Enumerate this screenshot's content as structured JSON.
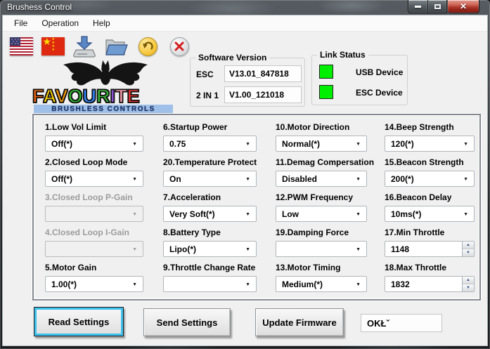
{
  "window": {
    "title": "Brushess Control"
  },
  "menu_bar": {
    "items": [
      {
        "label": "File"
      },
      {
        "label": "Operation"
      },
      {
        "label": "Help"
      }
    ]
  },
  "toolbar": {
    "buttons": [
      {
        "name": "english-language",
        "icon": "us-flag"
      },
      {
        "name": "chinese-language",
        "icon": "china-flag"
      },
      {
        "name": "save",
        "icon": "save-disk"
      },
      {
        "name": "open",
        "icon": "open-folder"
      },
      {
        "name": "undo",
        "icon": "undo-arrow"
      },
      {
        "name": "cancel",
        "icon": "cancel-x"
      }
    ]
  },
  "logo": {
    "text": "FAVOURITE",
    "letters": [
      {
        "ch": "F",
        "color": "#e8620c"
      },
      {
        "ch": "A",
        "color": "#ffd400"
      },
      {
        "ch": "V",
        "color": "#ff9d00"
      },
      {
        "ch": "O",
        "color": "#2eb82e"
      },
      {
        "ch": "U",
        "color": "#2e86ff"
      },
      {
        "ch": "R",
        "color": "#34b334"
      },
      {
        "ch": "I",
        "color": "#8a4fd3"
      },
      {
        "ch": "T",
        "color": "#ff9db0"
      },
      {
        "ch": "E",
        "color": "#e03131"
      }
    ],
    "subtitle": "BRUSHLESS CONTROLS"
  },
  "software_version": {
    "title": "Software Version",
    "rows": [
      {
        "label": "ESC",
        "value": "V13.01_847818"
      },
      {
        "label": "2 IN 1",
        "value": "V1.00_121018"
      }
    ]
  },
  "link_status": {
    "title": "Link Status",
    "indicator_color": "#00ee00",
    "items": [
      {
        "label": "USB Device"
      },
      {
        "label": "ESC Device"
      }
    ]
  },
  "settings": {
    "columns": [
      {
        "fields": [
          {
            "label": "1.Low Vol Limit",
            "value": "Off(*)",
            "type": "combo",
            "enabled": true
          },
          {
            "label": "2.Closed Loop Mode",
            "value": "Off(*)",
            "type": "combo",
            "enabled": true
          },
          {
            "label": "3.Closed Loop P-Gain",
            "value": "",
            "type": "combo",
            "enabled": false
          },
          {
            "label": "4.Closed Loop I-Gain",
            "value": "",
            "type": "combo",
            "enabled": false
          },
          {
            "label": "5.Motor Gain",
            "value": "1.00(*)",
            "type": "combo",
            "enabled": true
          }
        ]
      },
      {
        "fields": [
          {
            "label": "6.Startup Power",
            "value": "0.75",
            "type": "combo",
            "enabled": true
          },
          {
            "label": "20.Temperature Protect",
            "value": "On",
            "type": "combo",
            "enabled": true
          },
          {
            "label": "7.Acceleration",
            "value": "Very Soft(*)",
            "type": "combo",
            "enabled": true
          },
          {
            "label": "8.Battery Type",
            "value": "Lipo(*)",
            "type": "combo",
            "enabled": true
          },
          {
            "label": "9.Throttle Change Rate",
            "value": "",
            "type": "combo",
            "enabled": true
          }
        ]
      },
      {
        "fields": [
          {
            "label": "10.Motor Direction",
            "value": "Normal(*)",
            "type": "combo",
            "enabled": true
          },
          {
            "label": "11.Demag Compersation",
            "value": "Disabled",
            "type": "combo",
            "enabled": true
          },
          {
            "label": "12.PWM Frequency",
            "value": "Low",
            "type": "combo",
            "enabled": true
          },
          {
            "label": "19.Damping Force",
            "value": "",
            "type": "combo",
            "enabled": true
          },
          {
            "label": "13.Motor Timing",
            "value": "Medium(*)",
            "type": "combo",
            "enabled": true
          }
        ]
      },
      {
        "fields": [
          {
            "label": "14.Beep Strength",
            "value": "120(*)",
            "type": "combo",
            "enabled": true
          },
          {
            "label": "15.Beacon Strength",
            "value": "200(*)",
            "type": "combo",
            "enabled": true
          },
          {
            "label": "16.Beacon Delay",
            "value": "10ms(*)",
            "type": "combo",
            "enabled": true
          },
          {
            "label": "17.Min Throttle",
            "value": "1148",
            "type": "spinner",
            "enabled": true
          },
          {
            "label": "18.Max Throttle",
            "value": "1832",
            "type": "spinner",
            "enabled": true
          }
        ]
      }
    ]
  },
  "actions": {
    "read_settings": "Read Settings",
    "send_settings": "Send Settings",
    "update_firmware": "Update Firmware",
    "status_value": "OKŁˇ"
  }
}
